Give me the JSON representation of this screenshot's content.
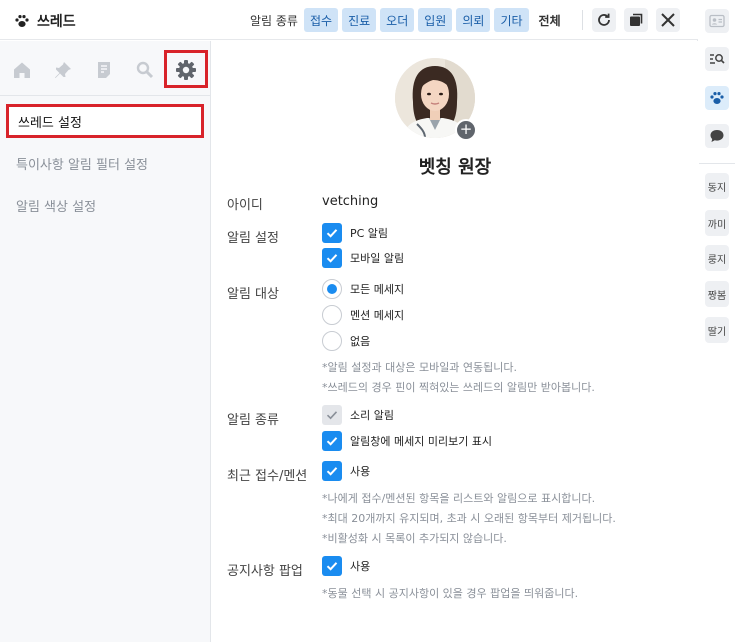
{
  "header": {
    "title": "쓰레드",
    "filter_label": "알림 종류",
    "filters": [
      "접수",
      "진료",
      "오더",
      "입원",
      "의뢰",
      "기타"
    ],
    "filter_all": "전체"
  },
  "sidebar": {
    "menu": [
      {
        "label": "쓰레드 설정",
        "active": true
      },
      {
        "label": "특이사항 알림 필터 설정",
        "active": false
      },
      {
        "label": "알림 색상 설정",
        "active": false
      }
    ]
  },
  "profile": {
    "name": "벳칭 원장",
    "add_symbol": "+"
  },
  "settings": {
    "id_label": "아이디",
    "id_value": "vetching",
    "alert_label": "알림 설정",
    "alert_pc": "PC 알림",
    "alert_mobile": "모바일 알림",
    "target_label": "알림 대상",
    "target_all": "모든 메세지",
    "target_mention": "멘션 메세지",
    "target_none": "없음",
    "target_note1": "*알림 설정과 대상은 모바일과 연동됩니다.",
    "target_note2": "*쓰레드의 경우 핀이 찍혀있는 쓰레드의 알림만 받아봅니다.",
    "type_label": "알림 종류",
    "type_sound": "소리 알림",
    "type_preview": "알림창에 메세지 미리보기 표시",
    "recent_label": "최근 접수/멘션",
    "recent_use": "사용",
    "recent_note1": "*나에게 접수/멘션된 항목을 리스트와 알림으로 표시합니다.",
    "recent_note2": "*최대 20개까지 유지되며, 초과 시 오래된 항목부터 제거됩니다.",
    "recent_note3": "*비활성화 시 목록이 추가되지 않습니다.",
    "notice_label": "공지사항 팝업",
    "notice_use": "사용",
    "notice_note": "*동물 선택 시 공지사항이 있을 경우 팝업을 띄워줍니다."
  },
  "rail": {
    "tabs": [
      "동지",
      "까미",
      "룽지",
      "짱봄",
      "딸기"
    ]
  },
  "colors": {
    "accent": "#1a8cf0",
    "chip_bg": "#cfe3f7",
    "highlight": "#d8232a"
  },
  "icons": [
    "paw-icon",
    "refresh-icon",
    "copy-icon",
    "close-icon",
    "home-icon",
    "pin-icon",
    "note-icon",
    "search-icon",
    "gear-icon",
    "contact-icon",
    "search-list-icon",
    "chat-icon"
  ]
}
